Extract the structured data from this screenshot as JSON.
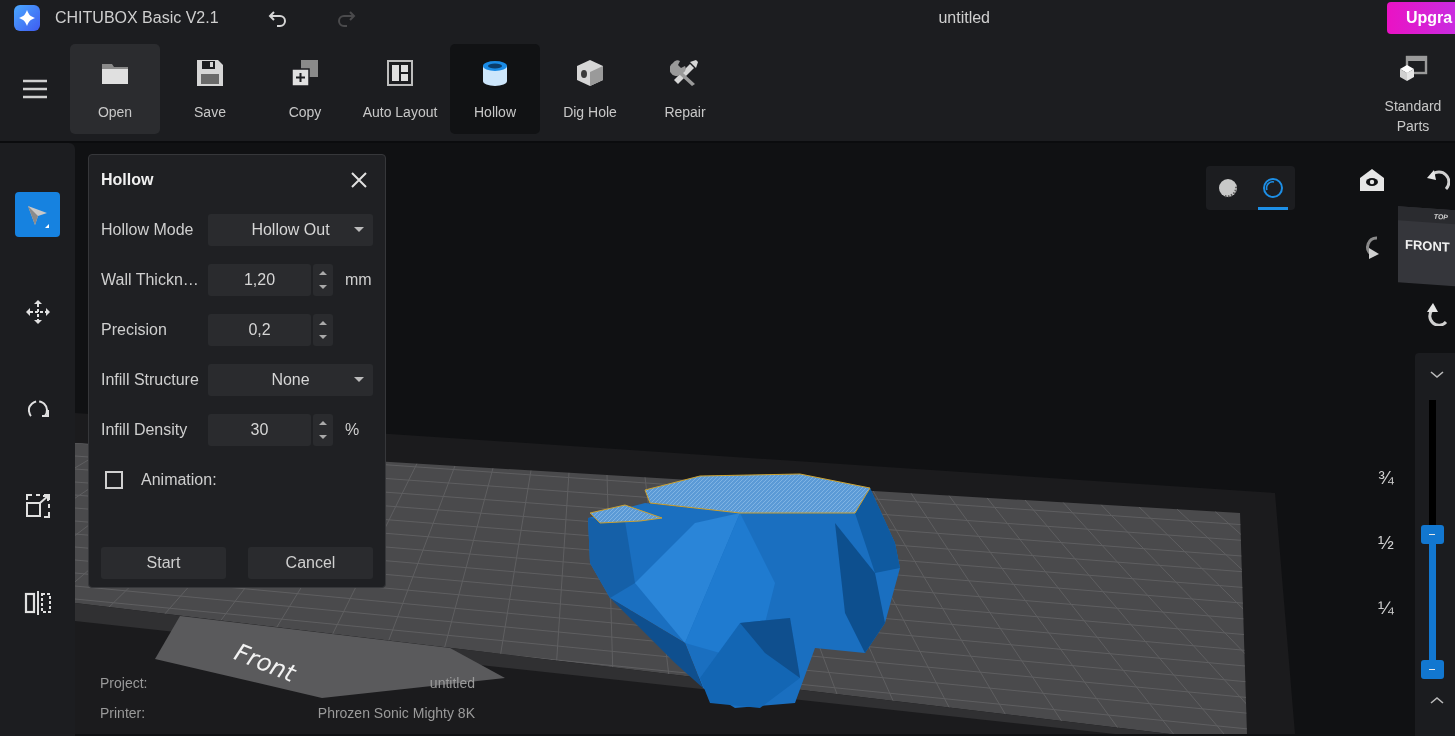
{
  "app": {
    "name": "CHITUBOX Basic V2.1",
    "document_title": "untitled",
    "upgrade_button": "Upgra"
  },
  "history": [
    {
      "kind": "undo",
      "disabled": false
    },
    {
      "kind": "redo",
      "disabled": true
    }
  ],
  "toolbar": {
    "items": [
      {
        "kind": "open",
        "label": "Open",
        "selected": false,
        "hovered": true
      },
      {
        "kind": "save",
        "label": "Save",
        "selected": false,
        "hovered": false
      },
      {
        "kind": "copy",
        "label": "Copy",
        "selected": false,
        "hovered": false
      },
      {
        "kind": "layout",
        "label": "Auto Layout",
        "selected": false,
        "hovered": false
      },
      {
        "kind": "hollow",
        "label": "Hollow",
        "selected": true,
        "hovered": false
      },
      {
        "kind": "dig",
        "label": "Dig Hole",
        "selected": false,
        "hovered": false
      },
      {
        "kind": "repair",
        "label": "Repair",
        "selected": false,
        "hovered": false
      }
    ],
    "standard_parts": {
      "label": "Standard Parts"
    }
  },
  "sidebar": {
    "tools": [
      {
        "kind": "select",
        "selected": true
      },
      {
        "kind": "move",
        "selected": false
      },
      {
        "kind": "rotate",
        "selected": false
      },
      {
        "kind": "scale",
        "selected": false
      },
      {
        "kind": "mirror",
        "selected": false
      }
    ]
  },
  "dialog": {
    "title": "Hollow",
    "fields": [
      {
        "kind": "dropdown",
        "label": "Hollow Mode",
        "value": "Hollow Out"
      },
      {
        "kind": "spinner",
        "label": "Wall Thickn…",
        "value": "1,20",
        "unit": "mm"
      },
      {
        "kind": "spinner",
        "label": "Precision",
        "value": "0,2"
      },
      {
        "kind": "dropdown",
        "label": "Infill Structure",
        "value": "None"
      },
      {
        "kind": "spinner",
        "label": "Infill Density",
        "value": "30",
        "unit": "%"
      }
    ],
    "animation": {
      "label": "Animation:",
      "checked": false
    },
    "buttons": [
      "Start",
      "Cancel"
    ]
  },
  "viewport": {
    "view_modes": [
      {
        "kind": "solid",
        "selected": false
      },
      {
        "kind": "xray",
        "selected": true
      }
    ],
    "view_cube": {
      "front": "FRONT",
      "top": "TOP"
    },
    "plate_label": "Front",
    "info": [
      {
        "label": "Project:",
        "value": "untitled"
      },
      {
        "label": "Printer:",
        "value": "Phrozen Sonic Mighty 8K"
      }
    ],
    "layer_slider": {
      "marks": [
        "¾",
        "½",
        "¼"
      ],
      "level": 0.5
    }
  }
}
